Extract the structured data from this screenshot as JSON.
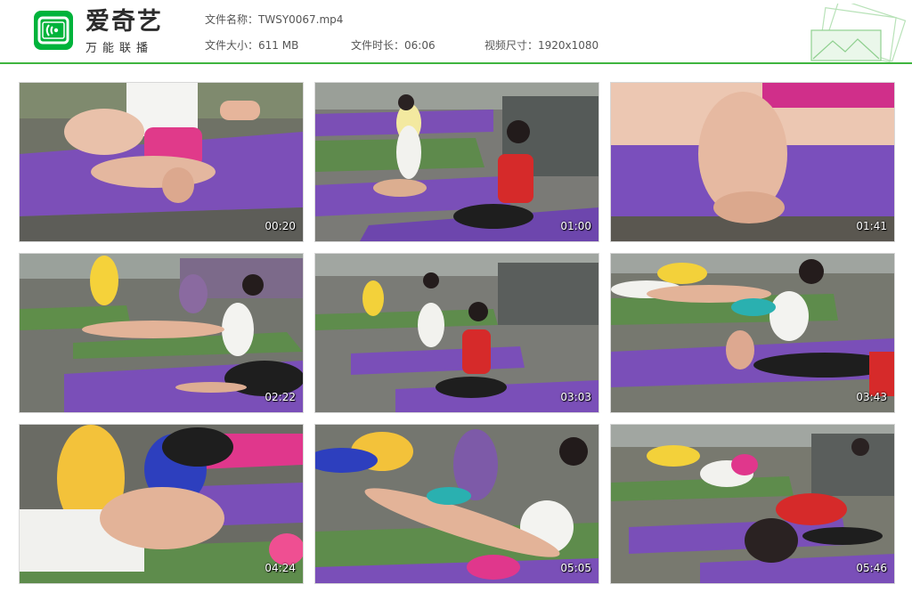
{
  "brand": {
    "name": "爱奇艺",
    "slogan": "万能联播"
  },
  "meta": {
    "file_name": "文件名称：TWSY0067.mp4",
    "file_size": "文件大小：611 MB",
    "duration": "文件时长：06:06",
    "dimensions": "视频尺寸：1920x1080"
  },
  "colors": {
    "accent": "#3fb53f",
    "logo": "#00b33b"
  },
  "thumbnails": [
    {
      "time": "00:20"
    },
    {
      "time": "01:00"
    },
    {
      "time": "01:41"
    },
    {
      "time": "02:22"
    },
    {
      "time": "03:03"
    },
    {
      "time": "03:43"
    },
    {
      "time": "04:24"
    },
    {
      "time": "05:05"
    },
    {
      "time": "05:46"
    }
  ]
}
